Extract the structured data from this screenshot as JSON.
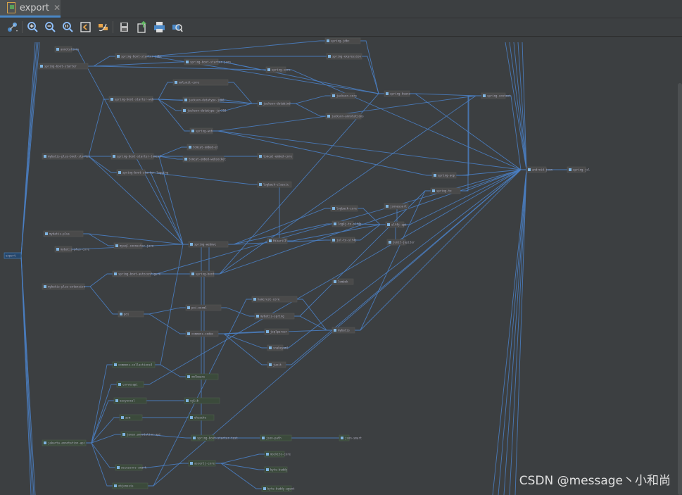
{
  "tab": {
    "title": "export",
    "close_glyph": "✕"
  },
  "toolbar": {
    "buttons": [
      {
        "id": "layout",
        "icon": "layout-icon"
      },
      {
        "id": "zoom-in",
        "icon": "zoom-in-icon"
      },
      {
        "id": "zoom-out",
        "icon": "zoom-out-icon"
      },
      {
        "id": "actual-size",
        "icon": "actual-size-icon"
      },
      {
        "id": "fit-content",
        "icon": "fit-content-icon"
      },
      {
        "id": "refresh-layout",
        "icon": "refresh-layout-icon"
      },
      {
        "id": "save",
        "icon": "save-icon"
      },
      {
        "id": "export",
        "icon": "export-icon"
      },
      {
        "id": "print",
        "icon": "print-icon"
      },
      {
        "id": "print-preview",
        "icon": "print-preview-icon"
      }
    ]
  },
  "diagram": {
    "root_label": "export",
    "node_labels": [
      "annotations",
      "spring-boot-starter",
      "spring-boot-starter-jdbc",
      "spring-boot-starter-json",
      "spring-boot-starter-web",
      "spring-boot-starter-tomcat",
      "spring-boot-starter-logging",
      "mybatis-plus-boot-starter",
      "mybatis-plus",
      "mybatis-plus-core",
      "mybatis-plus-extension",
      "spring-boot-autoconfigure",
      "spring-boot",
      "spring-core",
      "spring-jcl",
      "spring-beans",
      "spring-context",
      "spring-aop",
      "spring-expression",
      "spring-jdbc",
      "spring-tx",
      "spring-web",
      "spring-webmvc",
      "jackson-databind",
      "jackson-core",
      "jackson-annotations",
      "jackson-datatype-jdk8",
      "jackson-datatype-jsr310",
      "tomcat-embed-core",
      "tomcat-embed-el",
      "tomcat-embed-websocket",
      "logback-classic",
      "logback-core",
      "log4j-to-slf4j",
      "jul-to-slf4j",
      "slf4j-api",
      "HikariCP",
      "mysql-connector-java",
      "lombok",
      "mybatis",
      "mybatis-spring",
      "jsqlparser",
      "snakeyaml",
      "junit",
      "hamcrest-core",
      "poi",
      "poi-ooxml",
      "commons-codec",
      "commons-collections4",
      "xmlbeans",
      "curvesapi",
      "easyexcel",
      "cglib",
      "asm",
      "ehcache",
      "javax.annotation-api",
      "jakarta.annotation-api",
      "spring-boot-starter-test",
      "json-path",
      "json-smart",
      "accessors-smart",
      "assertj-core",
      "mockito-core",
      "byte-buddy",
      "byte-buddy-agent",
      "objenesis",
      "xmlunit-core",
      "jsonassert",
      "android-json",
      "junit-jupiter"
    ]
  },
  "watermark": "CSDN @message丶小和尚"
}
